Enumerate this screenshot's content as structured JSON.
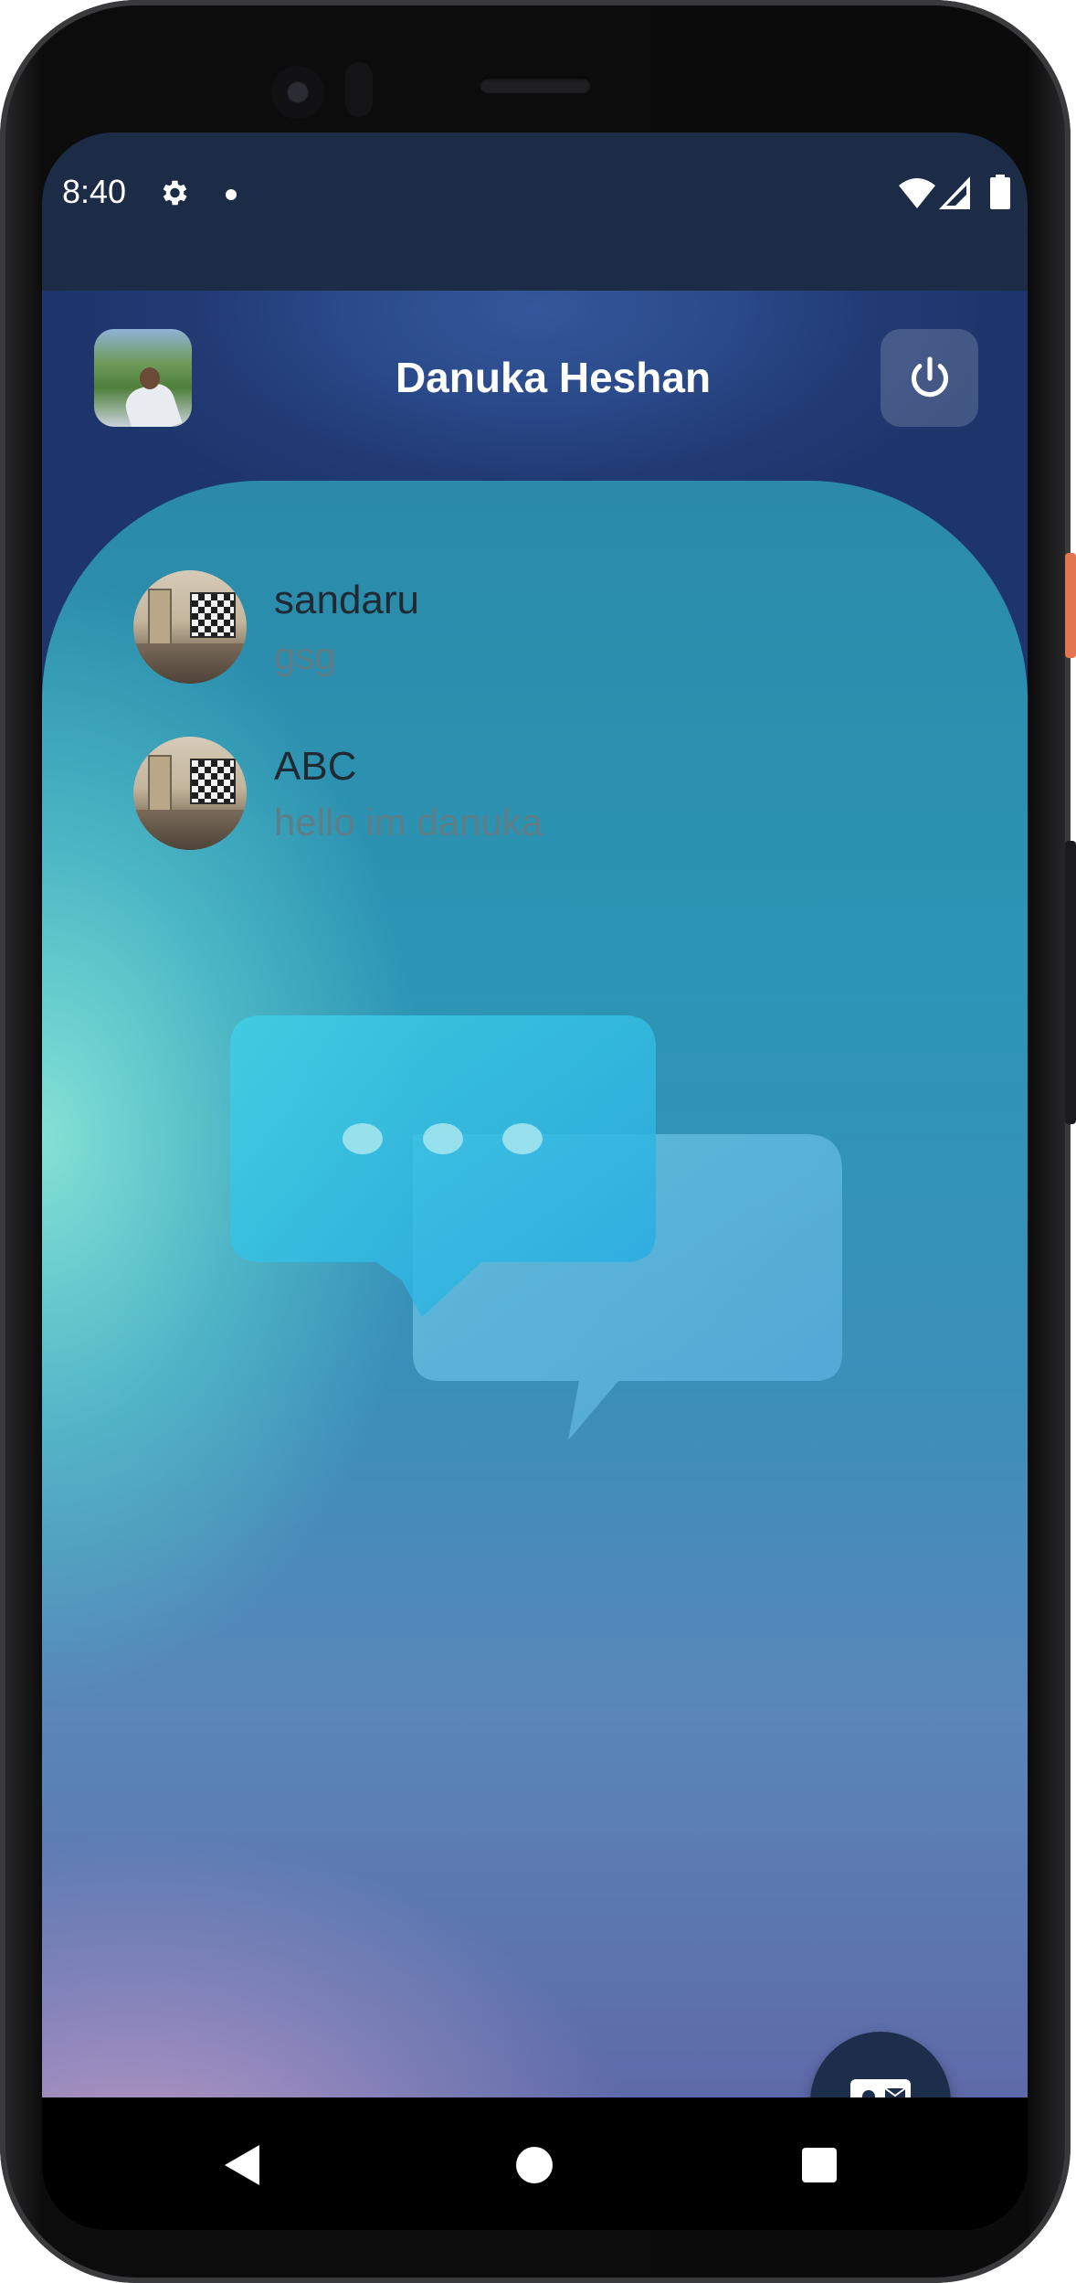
{
  "status_bar": {
    "time": "8:40",
    "icons": [
      "gear-icon",
      "notification-dot",
      "wifi-icon",
      "signal-icon",
      "battery-icon"
    ]
  },
  "header": {
    "title": "Danuka Heshan",
    "avatar_icon": "profile-photo",
    "power_icon": "power-icon"
  },
  "chats": [
    {
      "name": "sandaru",
      "last_message": "gsg"
    },
    {
      "name": "ABC",
      "last_message": "hello im danuka"
    }
  ],
  "fab": {
    "icon": "contact-mail-icon"
  },
  "nav": {
    "icons": [
      "back-icon",
      "home-icon",
      "recents-icon"
    ]
  },
  "colors": {
    "status_bar": "#1c2c47",
    "header_gradient_top": "#34579b",
    "fab": "#1c2e4b",
    "chat_name": "#1f2a33",
    "chat_preview": "#5f7d86"
  }
}
